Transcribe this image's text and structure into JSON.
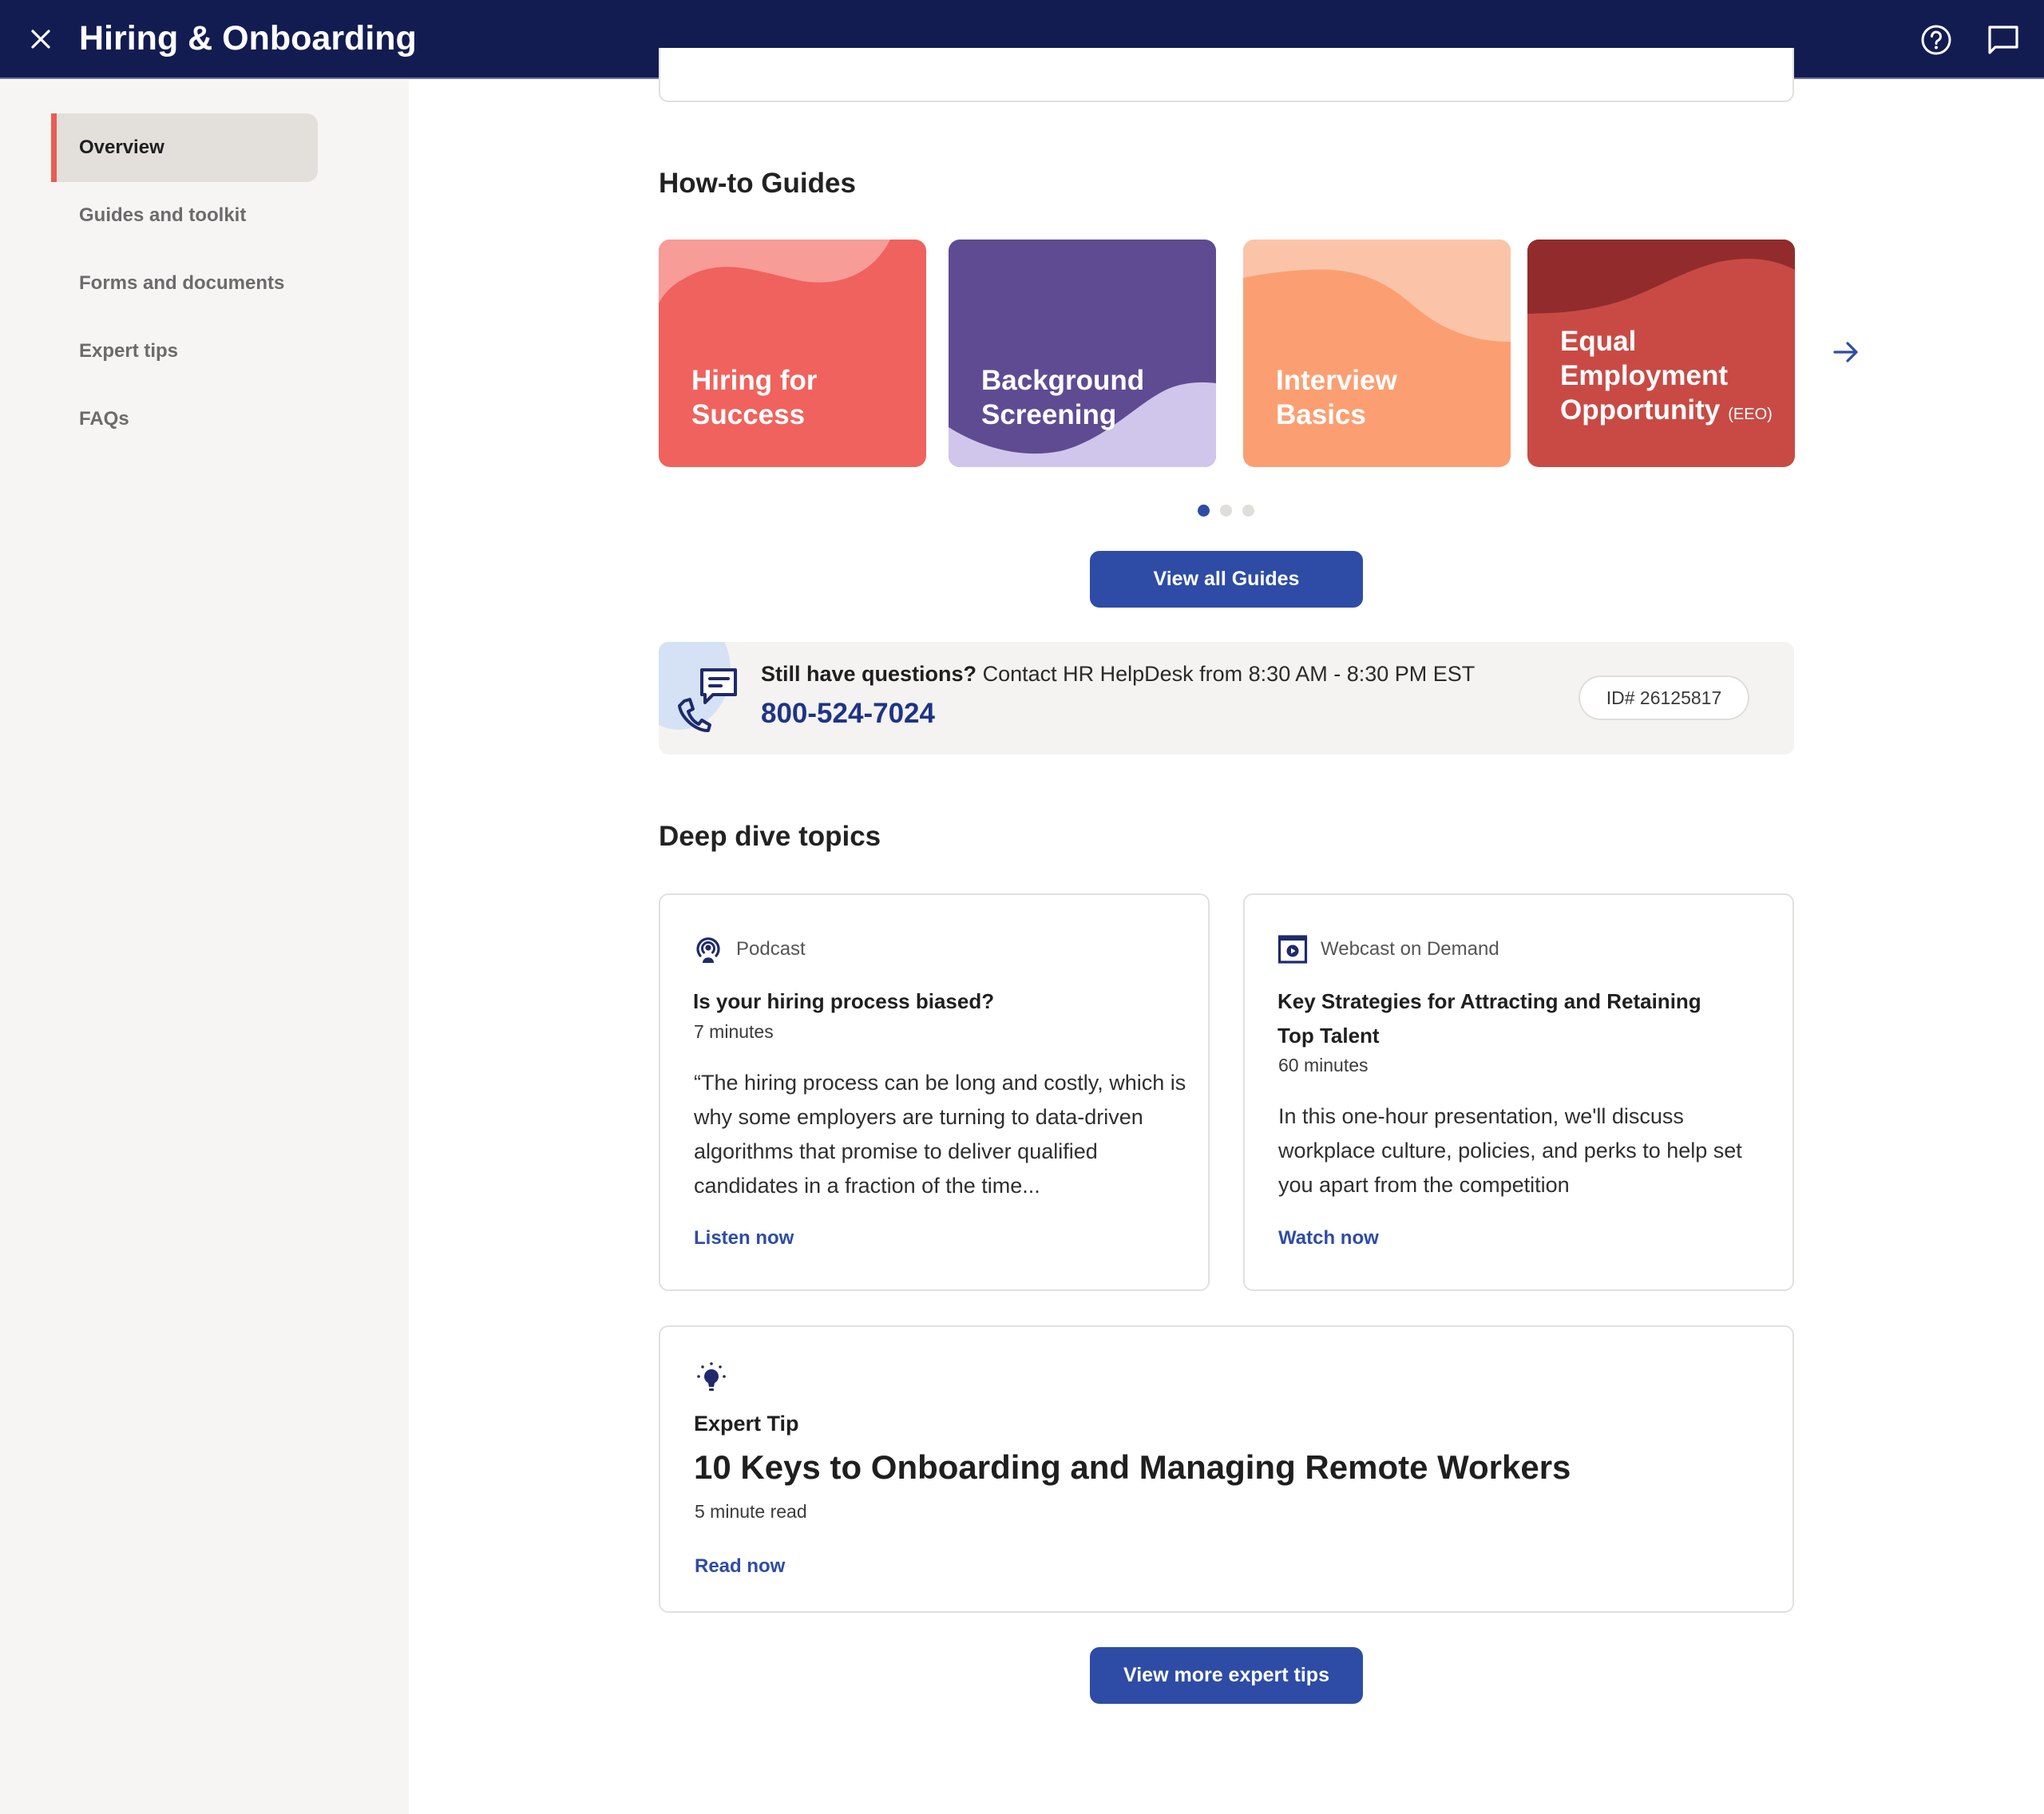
{
  "header": {
    "title": "Hiring & Onboarding",
    "close_icon": "close-icon",
    "help_icon": "help-circle-icon",
    "chat_icon": "chat-bubble-icon"
  },
  "sidebar": {
    "items": [
      {
        "label": "Overview",
        "active": true
      },
      {
        "label": "Guides and toolkit",
        "active": false
      },
      {
        "label": "Forms and documents",
        "active": false
      },
      {
        "label": "Expert tips",
        "active": false
      },
      {
        "label": "FAQs",
        "active": false
      }
    ]
  },
  "guides": {
    "heading": "How-to Guides",
    "cards": [
      {
        "title": "Hiring for Success",
        "line1": "Hiring for",
        "line2": "Success",
        "color": "#F0625D",
        "accent": "#F89C97"
      },
      {
        "title": "Background Screening",
        "line1": "Background",
        "line2": "Screening",
        "color": "#5F4B92",
        "accent": "#D0C6EB"
      },
      {
        "title": "Interview Basics",
        "line1": "Interview",
        "line2": "Basics",
        "color": "#FB9F72",
        "accent": "#FBC4A8"
      },
      {
        "title": "Equal Employment Opportunity (EEO)",
        "line1": "Equal",
        "line2": "Employment",
        "line3": "Opportunity",
        "suffix": "(EEO)",
        "color": "#C94A44",
        "accent": "#922C2C"
      }
    ],
    "next_icon": "arrow-right-icon",
    "pagination": {
      "total": 3,
      "current": 1
    },
    "view_all_label": "View all Guides"
  },
  "helpdesk": {
    "lead": "Still have questions?",
    "text": " Contact HR HelpDesk from 8:30 AM - 8:30 PM EST",
    "phone": "800-524-7024",
    "id": "ID# 26125817",
    "icon": "phone-chat-icon"
  },
  "deep_dive": {
    "heading": "Deep dive topics",
    "cards": [
      {
        "type": "Podcast",
        "icon": "podcast-icon",
        "title": "Is your hiring process biased?",
        "duration": "7 minutes",
        "description": "“The hiring process can be long and costly, which is why some employers are turning to data-driven algorithms that promise to deliver qualified candidates in a fraction of the time...",
        "cta": "Listen now"
      },
      {
        "type": "Webcast on Demand",
        "icon": "webcast-play-icon",
        "title": "Key Strategies for Attracting and Retaining Top Talent",
        "duration": "60 minutes",
        "description": "In this one-hour presentation, we'll discuss workplace culture, policies, and perks to help set you apart from the competition",
        "cta": "Watch now"
      }
    ]
  },
  "expert_tip": {
    "icon": "lightbulb-icon",
    "kind": "Expert Tip",
    "title": "10 Keys to Onboarding and Managing Remote Workers",
    "duration": "5 minute read",
    "cta": "Read now",
    "more_label": "View more expert tips"
  },
  "colors": {
    "header_bg": "#131C51",
    "primary": "#2E4CA6",
    "active_indicator": "#E85D55",
    "sidebar_bg": "#F7F5F3"
  }
}
